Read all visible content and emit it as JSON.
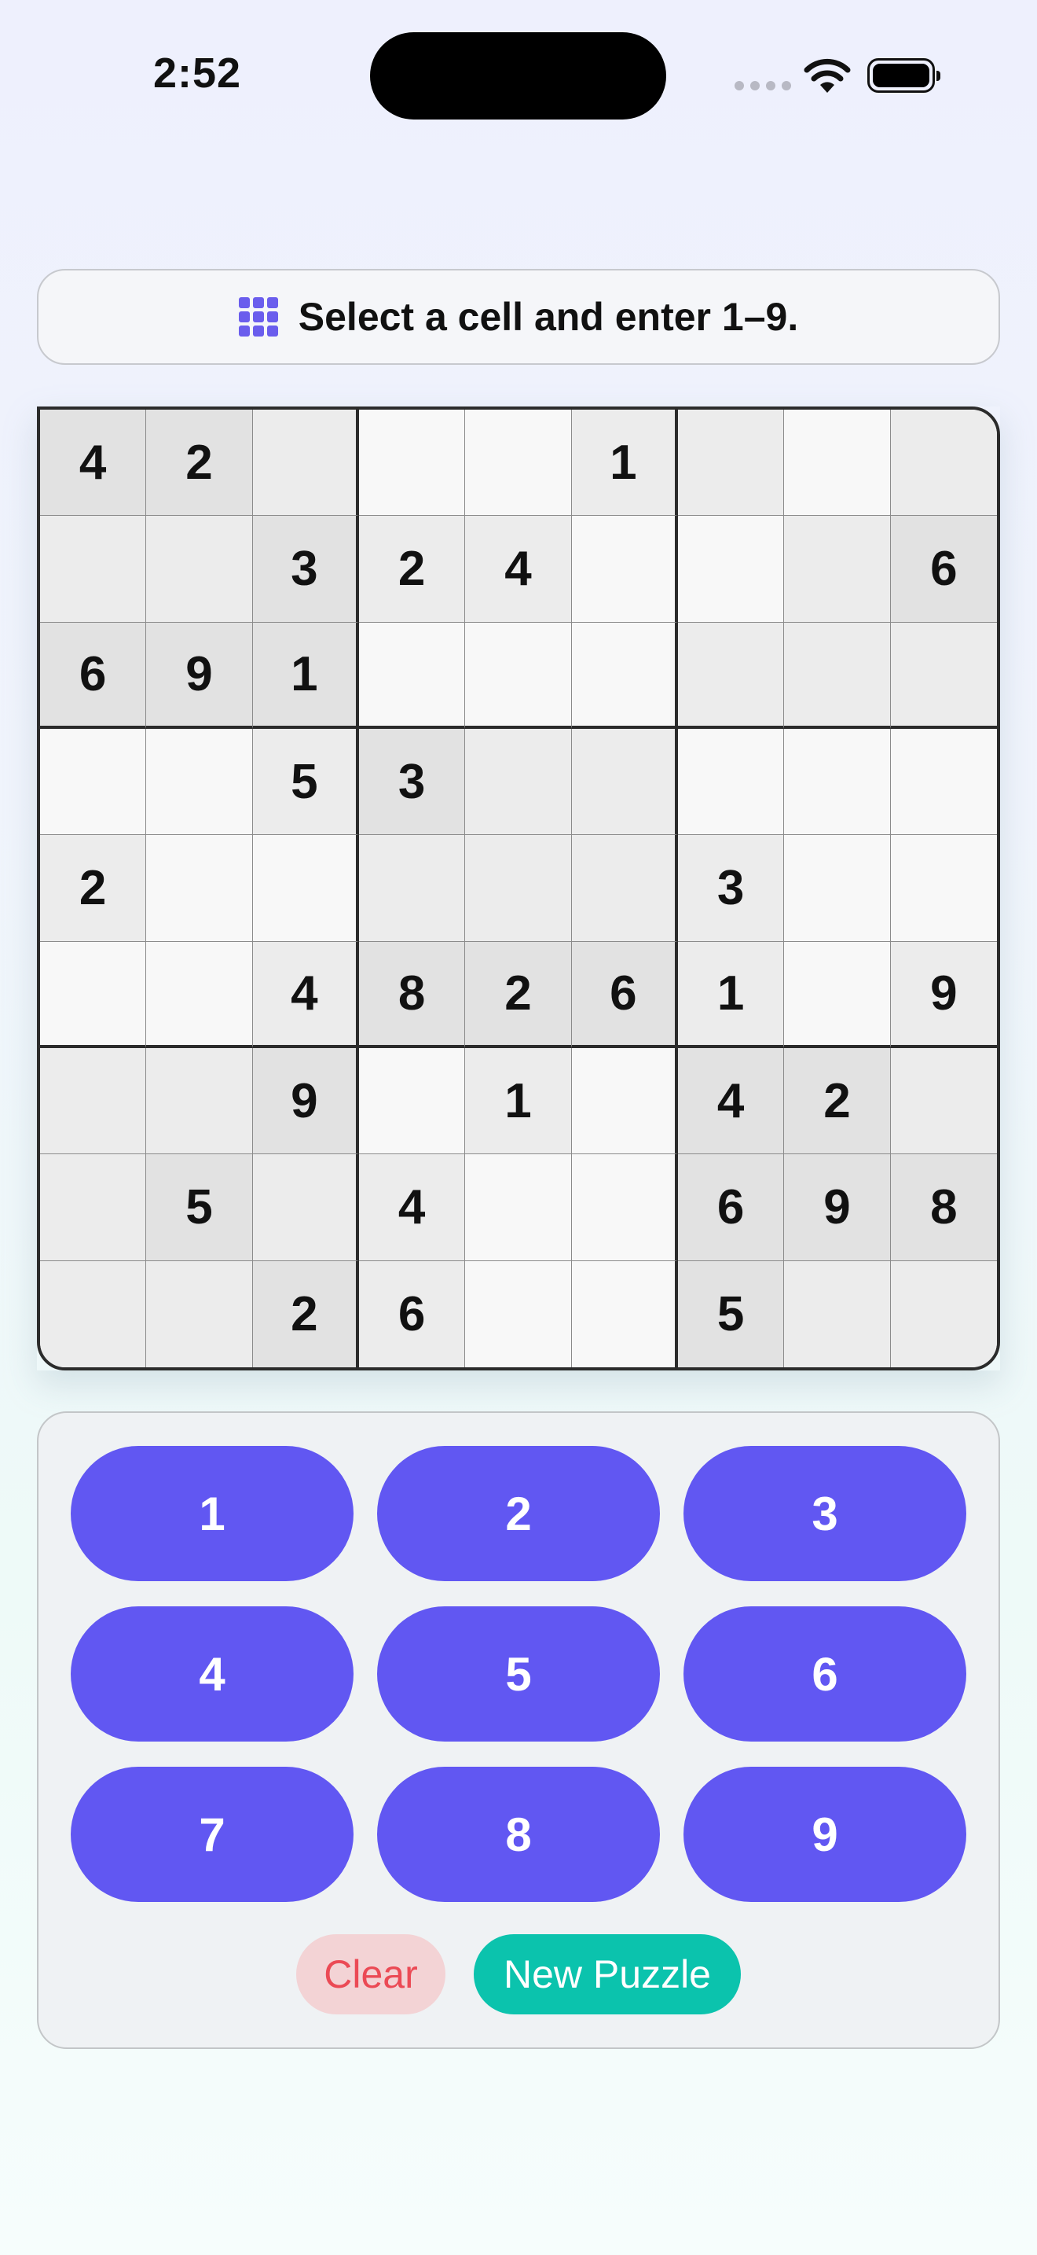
{
  "status_bar": {
    "time": "2:52",
    "icons": [
      "cellular-signal-icon",
      "wifi-icon",
      "battery-icon"
    ]
  },
  "banner": {
    "icon": "keypad-grid-icon",
    "message": "Select a cell and enter 1–9."
  },
  "board": {
    "rows": [
      [
        "4",
        "2",
        "",
        "",
        "",
        "1",
        "",
        "",
        ""
      ],
      [
        "",
        "",
        "3",
        "2",
        "4",
        "",
        "",
        "",
        "6"
      ],
      [
        "6",
        "9",
        "1",
        "",
        "",
        "",
        "",
        "",
        ""
      ],
      [
        "",
        "",
        "5",
        "3",
        "",
        "",
        "",
        "",
        ""
      ],
      [
        "2",
        "",
        "",
        "",
        "",
        "",
        "3",
        "",
        ""
      ],
      [
        "",
        "",
        "4",
        "8",
        "2",
        "6",
        "1",
        "",
        "9"
      ],
      [
        "",
        "",
        "9",
        "",
        "1",
        "",
        "4",
        "2",
        ""
      ],
      [
        "",
        "5",
        "",
        "4",
        "",
        "",
        "6",
        "9",
        "8"
      ],
      [
        "",
        "",
        "2",
        "6",
        "",
        "",
        "5",
        "",
        ""
      ]
    ],
    "shading": [
      [
        0,
        0,
        1,
        2,
        2,
        1,
        1,
        2,
        1
      ],
      [
        1,
        1,
        0,
        1,
        1,
        2,
        2,
        1,
        0
      ],
      [
        0,
        0,
        0,
        2,
        2,
        2,
        1,
        1,
        1
      ],
      [
        2,
        2,
        1,
        0,
        1,
        1,
        2,
        2,
        2
      ],
      [
        1,
        2,
        2,
        1,
        1,
        1,
        1,
        2,
        2
      ],
      [
        2,
        2,
        1,
        0,
        0,
        0,
        1,
        2,
        1
      ],
      [
        1,
        1,
        0,
        2,
        1,
        2,
        0,
        0,
        1
      ],
      [
        1,
        0,
        1,
        1,
        2,
        2,
        0,
        0,
        0
      ],
      [
        1,
        1,
        0,
        1,
        2,
        2,
        0,
        1,
        1
      ]
    ]
  },
  "keypad": {
    "keys": [
      "1",
      "2",
      "3",
      "4",
      "5",
      "6",
      "7",
      "8",
      "9"
    ],
    "clear_label": "Clear",
    "new_puzzle_label": "New Puzzle"
  },
  "colors": {
    "accent": "#6157f2",
    "clear_text": "#eb4a55",
    "clear_bg": "#f3d3d5",
    "new_puzzle_bg": "#0bc3ad"
  }
}
